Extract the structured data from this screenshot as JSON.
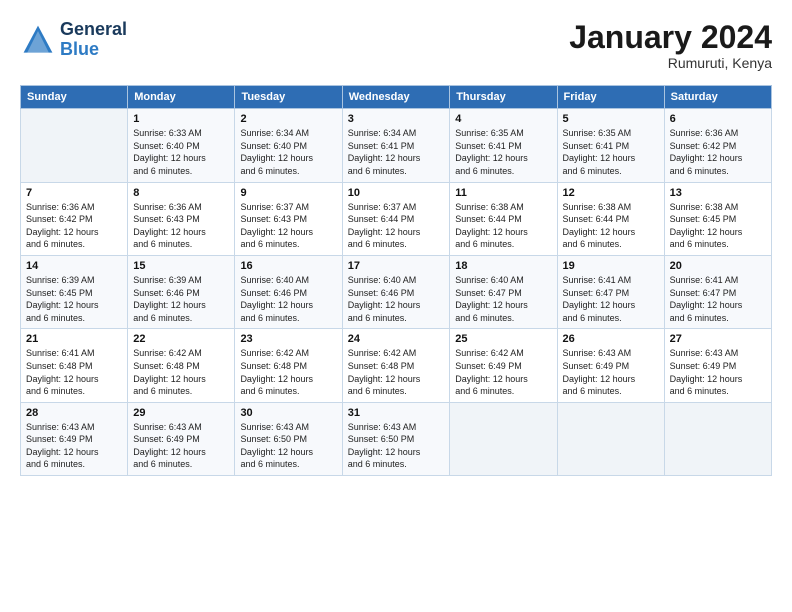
{
  "header": {
    "logo_line1": "General",
    "logo_line2": "Blue",
    "month": "January 2024",
    "location": "Rumuruti, Kenya"
  },
  "days_of_week": [
    "Sunday",
    "Monday",
    "Tuesday",
    "Wednesday",
    "Thursday",
    "Friday",
    "Saturday"
  ],
  "weeks": [
    [
      {
        "day": "",
        "info": ""
      },
      {
        "day": "1",
        "info": "Sunrise: 6:33 AM\nSunset: 6:40 PM\nDaylight: 12 hours\nand 6 minutes."
      },
      {
        "day": "2",
        "info": "Sunrise: 6:34 AM\nSunset: 6:40 PM\nDaylight: 12 hours\nand 6 minutes."
      },
      {
        "day": "3",
        "info": "Sunrise: 6:34 AM\nSunset: 6:41 PM\nDaylight: 12 hours\nand 6 minutes."
      },
      {
        "day": "4",
        "info": "Sunrise: 6:35 AM\nSunset: 6:41 PM\nDaylight: 12 hours\nand 6 minutes."
      },
      {
        "day": "5",
        "info": "Sunrise: 6:35 AM\nSunset: 6:41 PM\nDaylight: 12 hours\nand 6 minutes."
      },
      {
        "day": "6",
        "info": "Sunrise: 6:36 AM\nSunset: 6:42 PM\nDaylight: 12 hours\nand 6 minutes."
      }
    ],
    [
      {
        "day": "7",
        "info": "Sunrise: 6:36 AM\nSunset: 6:42 PM\nDaylight: 12 hours\nand 6 minutes."
      },
      {
        "day": "8",
        "info": "Sunrise: 6:36 AM\nSunset: 6:43 PM\nDaylight: 12 hours\nand 6 minutes."
      },
      {
        "day": "9",
        "info": "Sunrise: 6:37 AM\nSunset: 6:43 PM\nDaylight: 12 hours\nand 6 minutes."
      },
      {
        "day": "10",
        "info": "Sunrise: 6:37 AM\nSunset: 6:44 PM\nDaylight: 12 hours\nand 6 minutes."
      },
      {
        "day": "11",
        "info": "Sunrise: 6:38 AM\nSunset: 6:44 PM\nDaylight: 12 hours\nand 6 minutes."
      },
      {
        "day": "12",
        "info": "Sunrise: 6:38 AM\nSunset: 6:44 PM\nDaylight: 12 hours\nand 6 minutes."
      },
      {
        "day": "13",
        "info": "Sunrise: 6:38 AM\nSunset: 6:45 PM\nDaylight: 12 hours\nand 6 minutes."
      }
    ],
    [
      {
        "day": "14",
        "info": "Sunrise: 6:39 AM\nSunset: 6:45 PM\nDaylight: 12 hours\nand 6 minutes."
      },
      {
        "day": "15",
        "info": "Sunrise: 6:39 AM\nSunset: 6:46 PM\nDaylight: 12 hours\nand 6 minutes."
      },
      {
        "day": "16",
        "info": "Sunrise: 6:40 AM\nSunset: 6:46 PM\nDaylight: 12 hours\nand 6 minutes."
      },
      {
        "day": "17",
        "info": "Sunrise: 6:40 AM\nSunset: 6:46 PM\nDaylight: 12 hours\nand 6 minutes."
      },
      {
        "day": "18",
        "info": "Sunrise: 6:40 AM\nSunset: 6:47 PM\nDaylight: 12 hours\nand 6 minutes."
      },
      {
        "day": "19",
        "info": "Sunrise: 6:41 AM\nSunset: 6:47 PM\nDaylight: 12 hours\nand 6 minutes."
      },
      {
        "day": "20",
        "info": "Sunrise: 6:41 AM\nSunset: 6:47 PM\nDaylight: 12 hours\nand 6 minutes."
      }
    ],
    [
      {
        "day": "21",
        "info": "Sunrise: 6:41 AM\nSunset: 6:48 PM\nDaylight: 12 hours\nand 6 minutes."
      },
      {
        "day": "22",
        "info": "Sunrise: 6:42 AM\nSunset: 6:48 PM\nDaylight: 12 hours\nand 6 minutes."
      },
      {
        "day": "23",
        "info": "Sunrise: 6:42 AM\nSunset: 6:48 PM\nDaylight: 12 hours\nand 6 minutes."
      },
      {
        "day": "24",
        "info": "Sunrise: 6:42 AM\nSunset: 6:48 PM\nDaylight: 12 hours\nand 6 minutes."
      },
      {
        "day": "25",
        "info": "Sunrise: 6:42 AM\nSunset: 6:49 PM\nDaylight: 12 hours\nand 6 minutes."
      },
      {
        "day": "26",
        "info": "Sunrise: 6:43 AM\nSunset: 6:49 PM\nDaylight: 12 hours\nand 6 minutes."
      },
      {
        "day": "27",
        "info": "Sunrise: 6:43 AM\nSunset: 6:49 PM\nDaylight: 12 hours\nand 6 minutes."
      }
    ],
    [
      {
        "day": "28",
        "info": "Sunrise: 6:43 AM\nSunset: 6:49 PM\nDaylight: 12 hours\nand 6 minutes."
      },
      {
        "day": "29",
        "info": "Sunrise: 6:43 AM\nSunset: 6:49 PM\nDaylight: 12 hours\nand 6 minutes."
      },
      {
        "day": "30",
        "info": "Sunrise: 6:43 AM\nSunset: 6:50 PM\nDaylight: 12 hours\nand 6 minutes."
      },
      {
        "day": "31",
        "info": "Sunrise: 6:43 AM\nSunset: 6:50 PM\nDaylight: 12 hours\nand 6 minutes."
      },
      {
        "day": "",
        "info": ""
      },
      {
        "day": "",
        "info": ""
      },
      {
        "day": "",
        "info": ""
      }
    ]
  ]
}
